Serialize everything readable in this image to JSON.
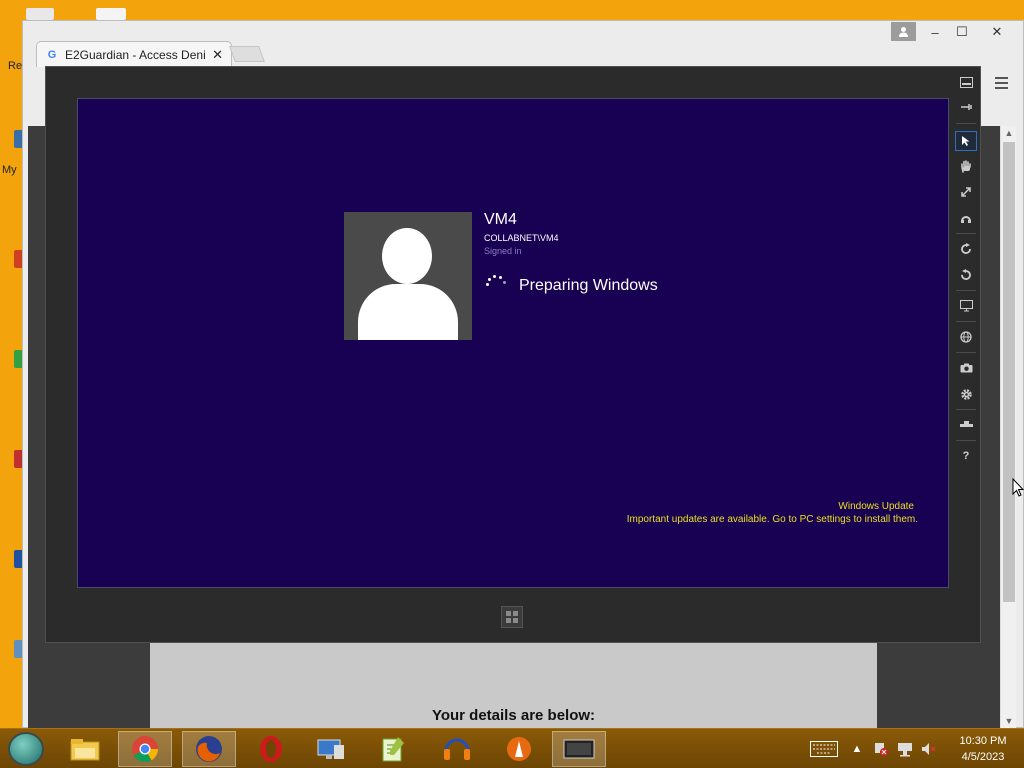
{
  "browser": {
    "tab_title": "E2Guardian - Access Deni",
    "tab_close": "✕",
    "window_controls": {
      "minimize": "–",
      "maximize": "☐",
      "close": "✕"
    },
    "user_icon": "person-icon"
  },
  "page": {
    "details_heading": "Your details are below:"
  },
  "desktop": {
    "partial_labels": [
      "Re",
      "My"
    ]
  },
  "vm_viewer": {
    "user": {
      "name": "VM4",
      "account": "COLLABNET\\VM4",
      "status": "Signed in"
    },
    "loading_text": "Preparing Windows",
    "notification": {
      "title": "Windows Update",
      "message": "Important updates are available. Go to PC settings to install them."
    },
    "toolbar": [
      "minimize-icon",
      "pin-icon",
      "pointer-icon",
      "hand-icon",
      "resize-icon",
      "refresh-icon",
      "rotate-cw-icon",
      "rotate-ccw-icon",
      "monitor-icon",
      "globe-icon",
      "camera-icon",
      "gear-icon",
      "usb-icon",
      "help-icon"
    ],
    "help_label": "?"
  },
  "taskbar": {
    "apps": [
      "file-explorer-icon",
      "chrome-icon",
      "firefox-icon",
      "opera-icon",
      "remote-desktop-icon",
      "notepad-plus-icon",
      "audacity-icon",
      "inkscape-icon",
      "vm-viewer-icon"
    ],
    "clock_time": "10:30 PM",
    "clock_date": "4/5/2023"
  },
  "colors": {
    "desktop": "#f3a40c",
    "vm_background": "#180052",
    "notification_text": "#e8e020",
    "viewer_frame": "#2b2b2b"
  }
}
